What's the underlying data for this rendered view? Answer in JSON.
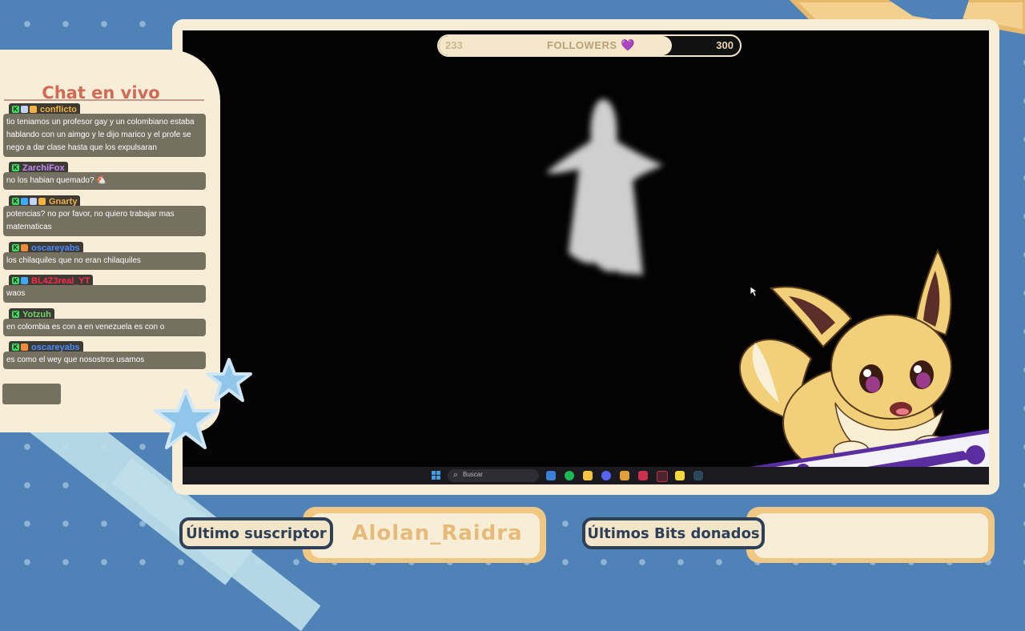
{
  "followers": {
    "current": "233",
    "label": "FOLLOWERS",
    "heart": "💜",
    "goal": "300",
    "progress": 0.78
  },
  "chat": {
    "title": "Chat en vivo",
    "messages": [
      {
        "name": "conflicto",
        "name_color": "#f2b340",
        "badges": [
          "K",
          "M",
          "!"
        ],
        "text": "tio teniamos un profesor gay y un colombiano estaba hablando con un aimgo y le dijo marico y el profe se nego a dar clase hasta que los expulsaran"
      },
      {
        "name": "ZarchiFox",
        "name_color": "#c58bff",
        "badges": [
          "K"
        ],
        "text": "no los habian quemado? 🐔"
      },
      {
        "name": "Gnarty",
        "name_color": "#f2b340",
        "badges": [
          "K",
          "S",
          "M",
          "!"
        ],
        "text": "potencias? no por favor, no quiero trabajar mas matematicas"
      },
      {
        "name": "oscareyabs",
        "name_color": "#4a8cff",
        "badges": [
          "K",
          "G"
        ],
        "text": "los chilaquiles que no eran chilaquiles"
      },
      {
        "name": "BL4Z3real_YT",
        "name_color": "#ff2b4a",
        "badges": [
          "K",
          "S"
        ],
        "text": "waos"
      },
      {
        "name": "Yotzuh",
        "name_color": "#6fd36f",
        "badges": [
          "K"
        ],
        "text": "en colombia es con a en venezuela es con o"
      },
      {
        "name": "oscareyabs",
        "name_color": "#4a8cff",
        "badges": [
          "K",
          "G"
        ],
        "text": "es como el wey que nosostros usamos"
      }
    ]
  },
  "taskbar": {
    "search_placeholder": "Buscar"
  },
  "bottom": {
    "last_sub_label": "Último suscriptor",
    "last_sub_name": "Alolan_Raidra",
    "last_bits_label": "Últimos Bits donados",
    "last_bits_value": ""
  },
  "colors": {
    "cream": "#f8eed8",
    "navy": "#2e3f58",
    "bg_blue": "#4f83b8",
    "accent_gold": "#e6bb7a"
  }
}
